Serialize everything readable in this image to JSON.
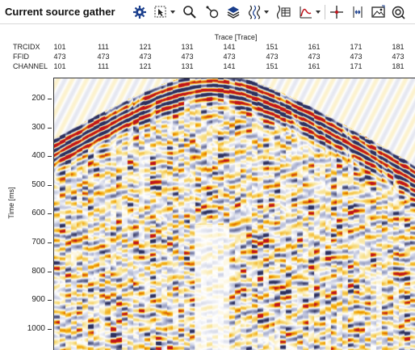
{
  "window": {
    "title": "Current source gather"
  },
  "toolbar": {
    "icons": [
      "gear-icon",
      "select-arrow-icon",
      "zoom-icon",
      "pick-icon",
      "layers-icon",
      "wiggle-icon",
      "header-table-icon",
      "spectrum-icon",
      "crosshair-icon",
      "expand-icon",
      "image-icon",
      "settings-target-icon"
    ]
  },
  "header": {
    "axis_title": "Trace [Trace]",
    "rows": [
      {
        "label": "TRCIDX",
        "values": [
          "101",
          "111",
          "121",
          "131",
          "141",
          "151",
          "161",
          "171",
          "181"
        ]
      },
      {
        "label": "FFID",
        "values": [
          "473",
          "473",
          "473",
          "473",
          "473",
          "473",
          "473",
          "473",
          "473"
        ]
      },
      {
        "label": "CHANNEL",
        "values": [
          "101",
          "111",
          "121",
          "131",
          "141",
          "151",
          "161",
          "171",
          "181"
        ]
      }
    ]
  },
  "yaxis": {
    "label": "Time [ms]",
    "ticks": [
      "200",
      "300",
      "400",
      "500",
      "600",
      "700",
      "800",
      "900",
      "1000"
    ]
  },
  "colors": {
    "positive": "#c0141c",
    "mid_positive": "#f2a300",
    "light_positive": "#f7e08a",
    "negative": "#2c2f5c",
    "light_negative": "#a9b0d0",
    "background": "#ffffff"
  }
}
